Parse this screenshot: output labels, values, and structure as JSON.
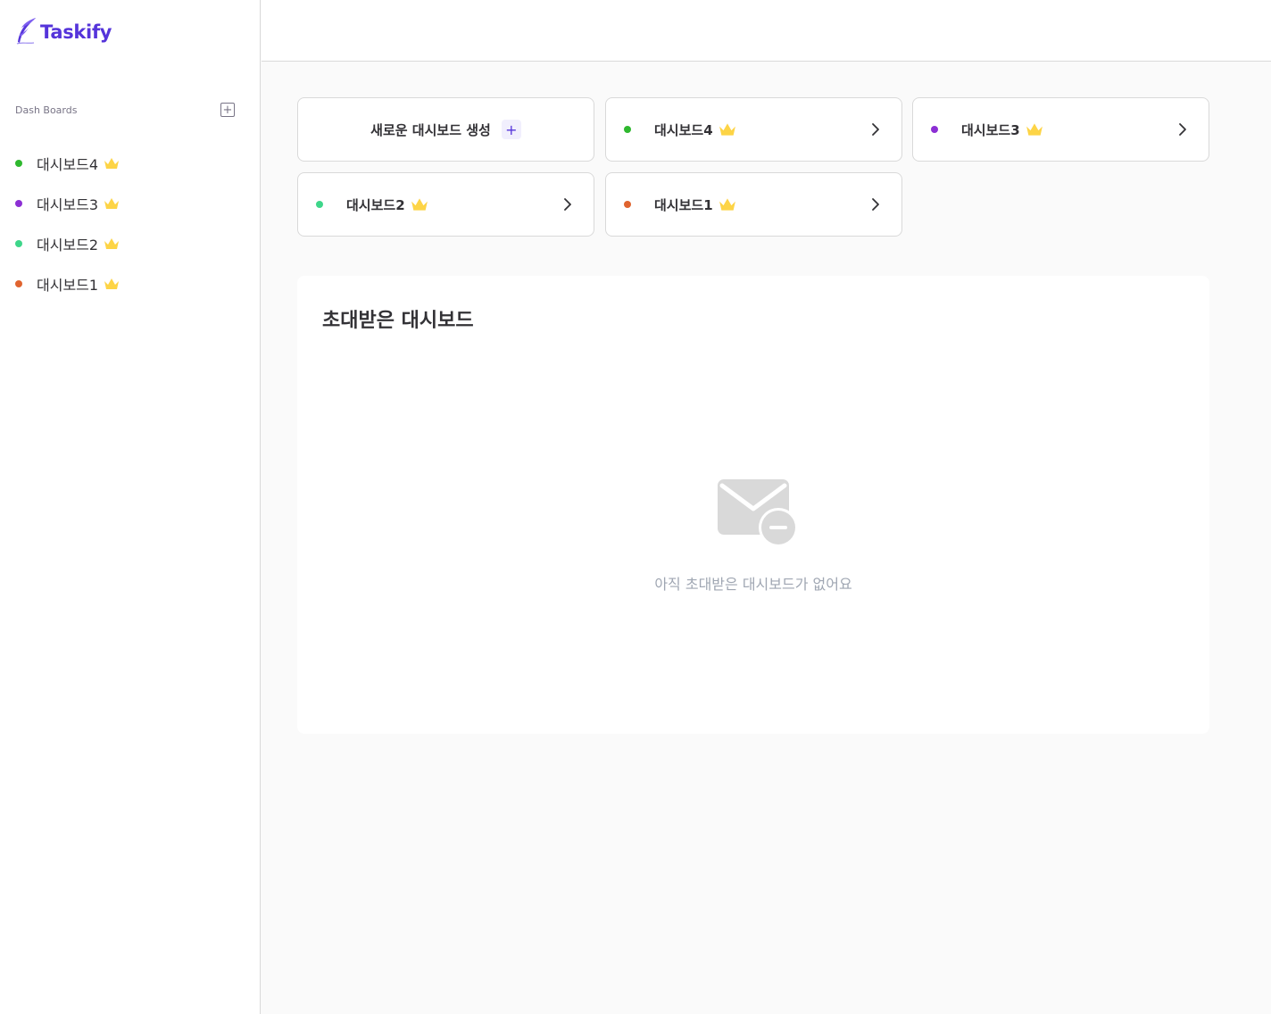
{
  "sidebar": {
    "logo_text": "Taskify",
    "section_label": "Dash Boards",
    "items": [
      {
        "name": "대시보드4",
        "color": "#2fb82f"
      },
      {
        "name": "대시보드3",
        "color": "#8c2fd4"
      },
      {
        "name": "대시보드2",
        "color": "#3ed68a"
      },
      {
        "name": "대시보드1",
        "color": "#e0642f"
      }
    ]
  },
  "main": {
    "new_dashboard_label": "새로운 대시보드 생성",
    "cards": [
      {
        "name": "대시보드4",
        "color": "#2fb82f"
      },
      {
        "name": "대시보드3",
        "color": "#8c2fd4"
      },
      {
        "name": "대시보드2",
        "color": "#3ed68a"
      },
      {
        "name": "대시보드1",
        "color": "#e0642f"
      }
    ],
    "invited_title": "초대받은 대시보드",
    "empty_message": "아직 초대받은 대시보드가 없어요"
  },
  "icons": {
    "logo": "feather-logo-icon",
    "add": "plus-box-icon",
    "owner": "crown-icon",
    "open": "chevron-right-icon",
    "empty": "mail-minus-icon"
  },
  "colors": {
    "brand": "#5534da",
    "crown": "#fdd446"
  }
}
